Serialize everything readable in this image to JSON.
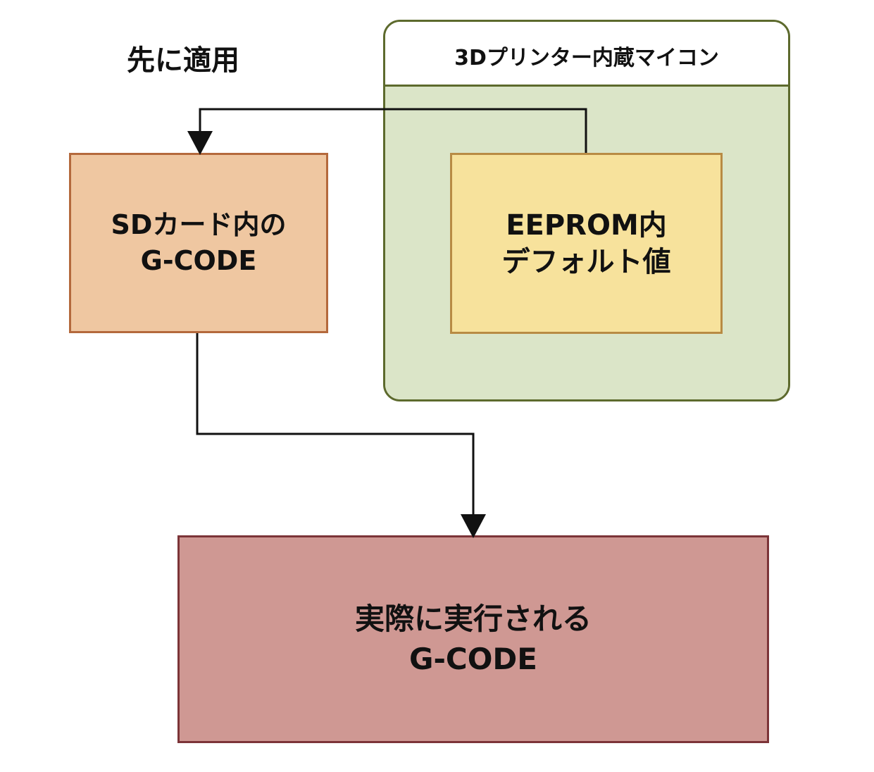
{
  "caption": "先に適用",
  "container": {
    "title": "3Dプリンター内蔵マイコン"
  },
  "boxes": {
    "sd": "SDカード内の\nG-CODE",
    "eeprom": "EEPROM内\nデフォルト値",
    "result": "実際に実行される\nG-CODE"
  },
  "colors": {
    "container_border": "#5d6a2d",
    "container_fill": "#dbe5c8",
    "sd_fill": "#efc7a1",
    "eeprom_fill": "#f7e29c",
    "result_fill": "#cf9893",
    "arrow": "#111111"
  }
}
